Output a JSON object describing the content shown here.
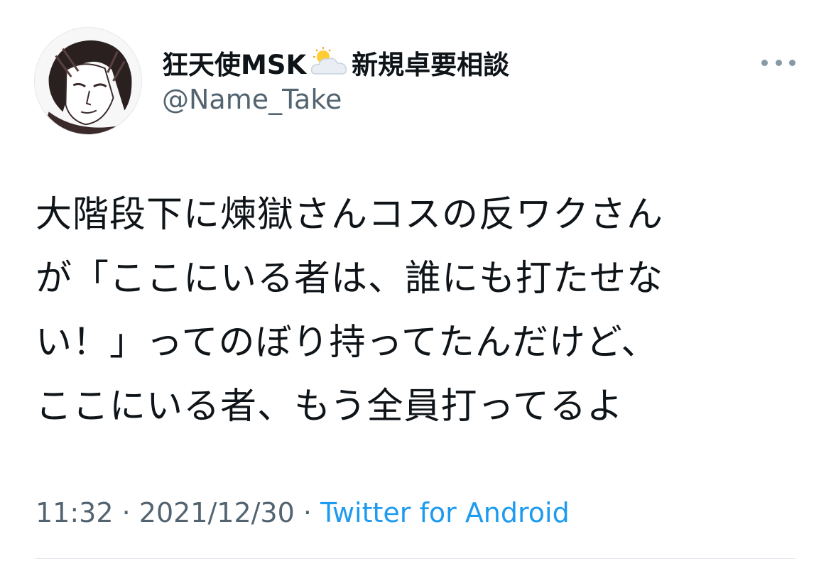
{
  "user": {
    "name_before": "狂天使MSK",
    "weather_icon": "sun-behind-cloud-icon",
    "name_after": "新規卓要相談",
    "handle": "@Name_Take"
  },
  "more_icon": "more-horizontal-icon",
  "tweet": {
    "lines": [
      "大階段下に煉獄さんコスの反ワクさん",
      "が「ここにいる者は、誰にも打たせな",
      "い！」ってのぼり持ってたんだけど、",
      "ここにいる者、もう全員打ってるよ"
    ]
  },
  "meta": {
    "time": "11:32",
    "sep1": " · ",
    "date": "2021/12/30",
    "sep2": " · ",
    "source": "Twitter for Android"
  },
  "colors": {
    "text": "#0f1419",
    "secondary": "#536471",
    "link": "#1d9bf0"
  }
}
